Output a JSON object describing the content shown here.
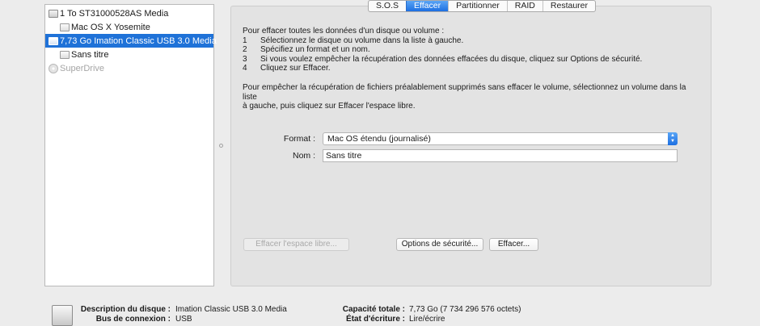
{
  "sidebar": {
    "items": [
      {
        "label": "1 To ST31000528AS Media",
        "icon": "hdd-icon",
        "state": "normal"
      },
      {
        "label": "Mac OS X Yosemite",
        "icon": "volume-icon",
        "state": "normal"
      },
      {
        "label": "7,73 Go Imation Classic USB 3.0 Media",
        "icon": "usb-drive-icon",
        "state": "selected"
      },
      {
        "label": "Sans titre",
        "icon": "volume-icon",
        "state": "normal"
      },
      {
        "label": "SuperDrive",
        "icon": "dvd-icon",
        "state": "disabled"
      }
    ]
  },
  "tabs": [
    "S.O.S",
    "Effacer",
    "Partitionner",
    "RAID",
    "Restaurer"
  ],
  "active_tab": "Effacer",
  "instructions": {
    "intro": "Pour effacer toutes les données d'un disque ou volume :",
    "steps": [
      {
        "num": "1",
        "text": "Sélectionnez le disque ou volume dans la liste à gauche."
      },
      {
        "num": "2",
        "text": "Spécifiez un format et un nom."
      },
      {
        "num": "3",
        "text": "Si vous voulez empêcher la récupération des données effacées du disque, cliquez sur Options de sécurité."
      },
      {
        "num": "4",
        "text": "Cliquez sur Effacer."
      }
    ],
    "para2_line1": "Pour empêcher la récupération de fichiers préalablement supprimés sans effacer le volume, sélectionnez un volume dans la liste",
    "para2_line2": "à gauche, puis cliquez sur Effacer l'espace libre."
  },
  "form": {
    "format_label": "Format :",
    "format_value": "Mac OS étendu (journalisé)",
    "name_label": "Nom :",
    "name_value": "Sans titre"
  },
  "buttons": {
    "erase_free_space": "Effacer l'espace libre...",
    "security_options": "Options de sécurité...",
    "erase": "Effacer..."
  },
  "footer": {
    "left": [
      {
        "label": "Description du disque :",
        "value": "Imation Classic USB 3.0 Media"
      },
      {
        "label": "Bus de connexion :",
        "value": "USB"
      }
    ],
    "right": [
      {
        "label": "Capacité totale :",
        "value": "7,73 Go (7 734 296 576 octets)"
      },
      {
        "label": "État d'écriture :",
        "value": "Lire/écrire"
      }
    ]
  },
  "colors": {
    "accent": "#1f72d8",
    "window_bg": "#ececec",
    "panel_bg": "#e3e3e3"
  }
}
